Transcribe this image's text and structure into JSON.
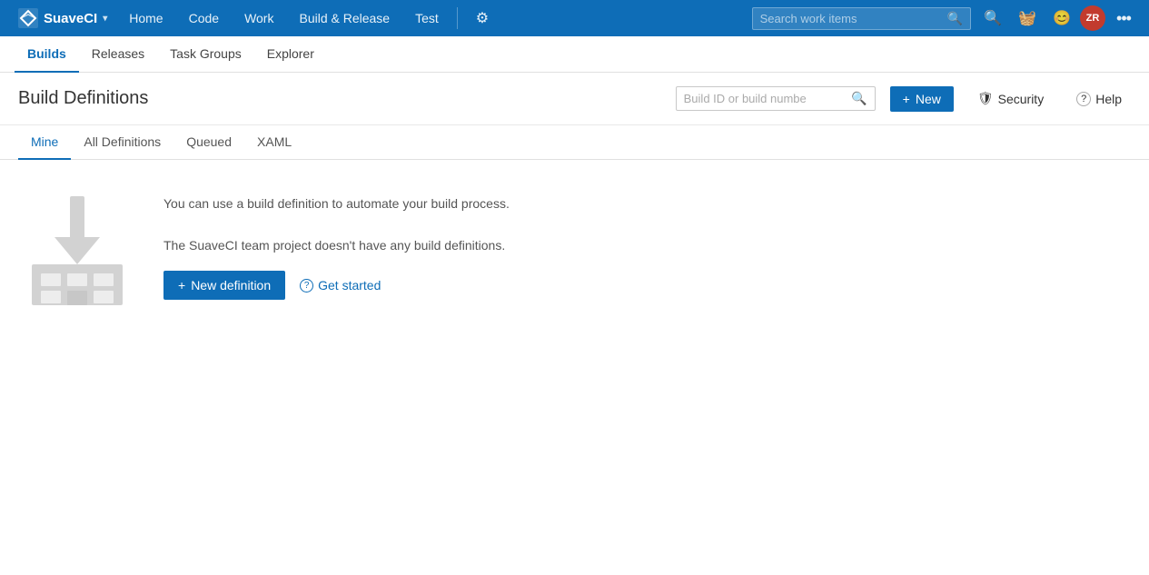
{
  "brand": {
    "name": "SuaveCI",
    "logo_alt": "Visual Studio logo",
    "chevron": "▾"
  },
  "top_nav": {
    "items": [
      {
        "id": "home",
        "label": "Home"
      },
      {
        "id": "code",
        "label": "Code"
      },
      {
        "id": "work",
        "label": "Work"
      },
      {
        "id": "build-release",
        "label": "Build & Release"
      },
      {
        "id": "test",
        "label": "Test"
      }
    ],
    "search_placeholder": "Search work items",
    "icons": {
      "search": "🔍",
      "basket": "🧺",
      "person": "😊",
      "more": "⋯"
    },
    "avatar_initials": "ZR"
  },
  "sub_nav": {
    "items": [
      {
        "id": "builds",
        "label": "Builds",
        "active": true
      },
      {
        "id": "releases",
        "label": "Releases",
        "active": false
      },
      {
        "id": "task-groups",
        "label": "Task Groups",
        "active": false
      },
      {
        "id": "explorer",
        "label": "Explorer",
        "active": false
      }
    ]
  },
  "page": {
    "title": "Build Definitions",
    "search_placeholder": "Build ID or build numbe",
    "new_button_label": "New",
    "security_button_label": "Security",
    "help_button_label": "Help"
  },
  "tabs": {
    "items": [
      {
        "id": "mine",
        "label": "Mine",
        "active": true
      },
      {
        "id": "all-definitions",
        "label": "All Definitions",
        "active": false
      },
      {
        "id": "queued",
        "label": "Queued",
        "active": false
      },
      {
        "id": "xaml",
        "label": "XAML",
        "active": false
      }
    ]
  },
  "content": {
    "description": "You can use a build definition to automate your build process.",
    "empty_message": "The SuaveCI team project doesn't have any build definitions.",
    "new_definition_label": "New definition",
    "get_started_label": "Get started"
  }
}
